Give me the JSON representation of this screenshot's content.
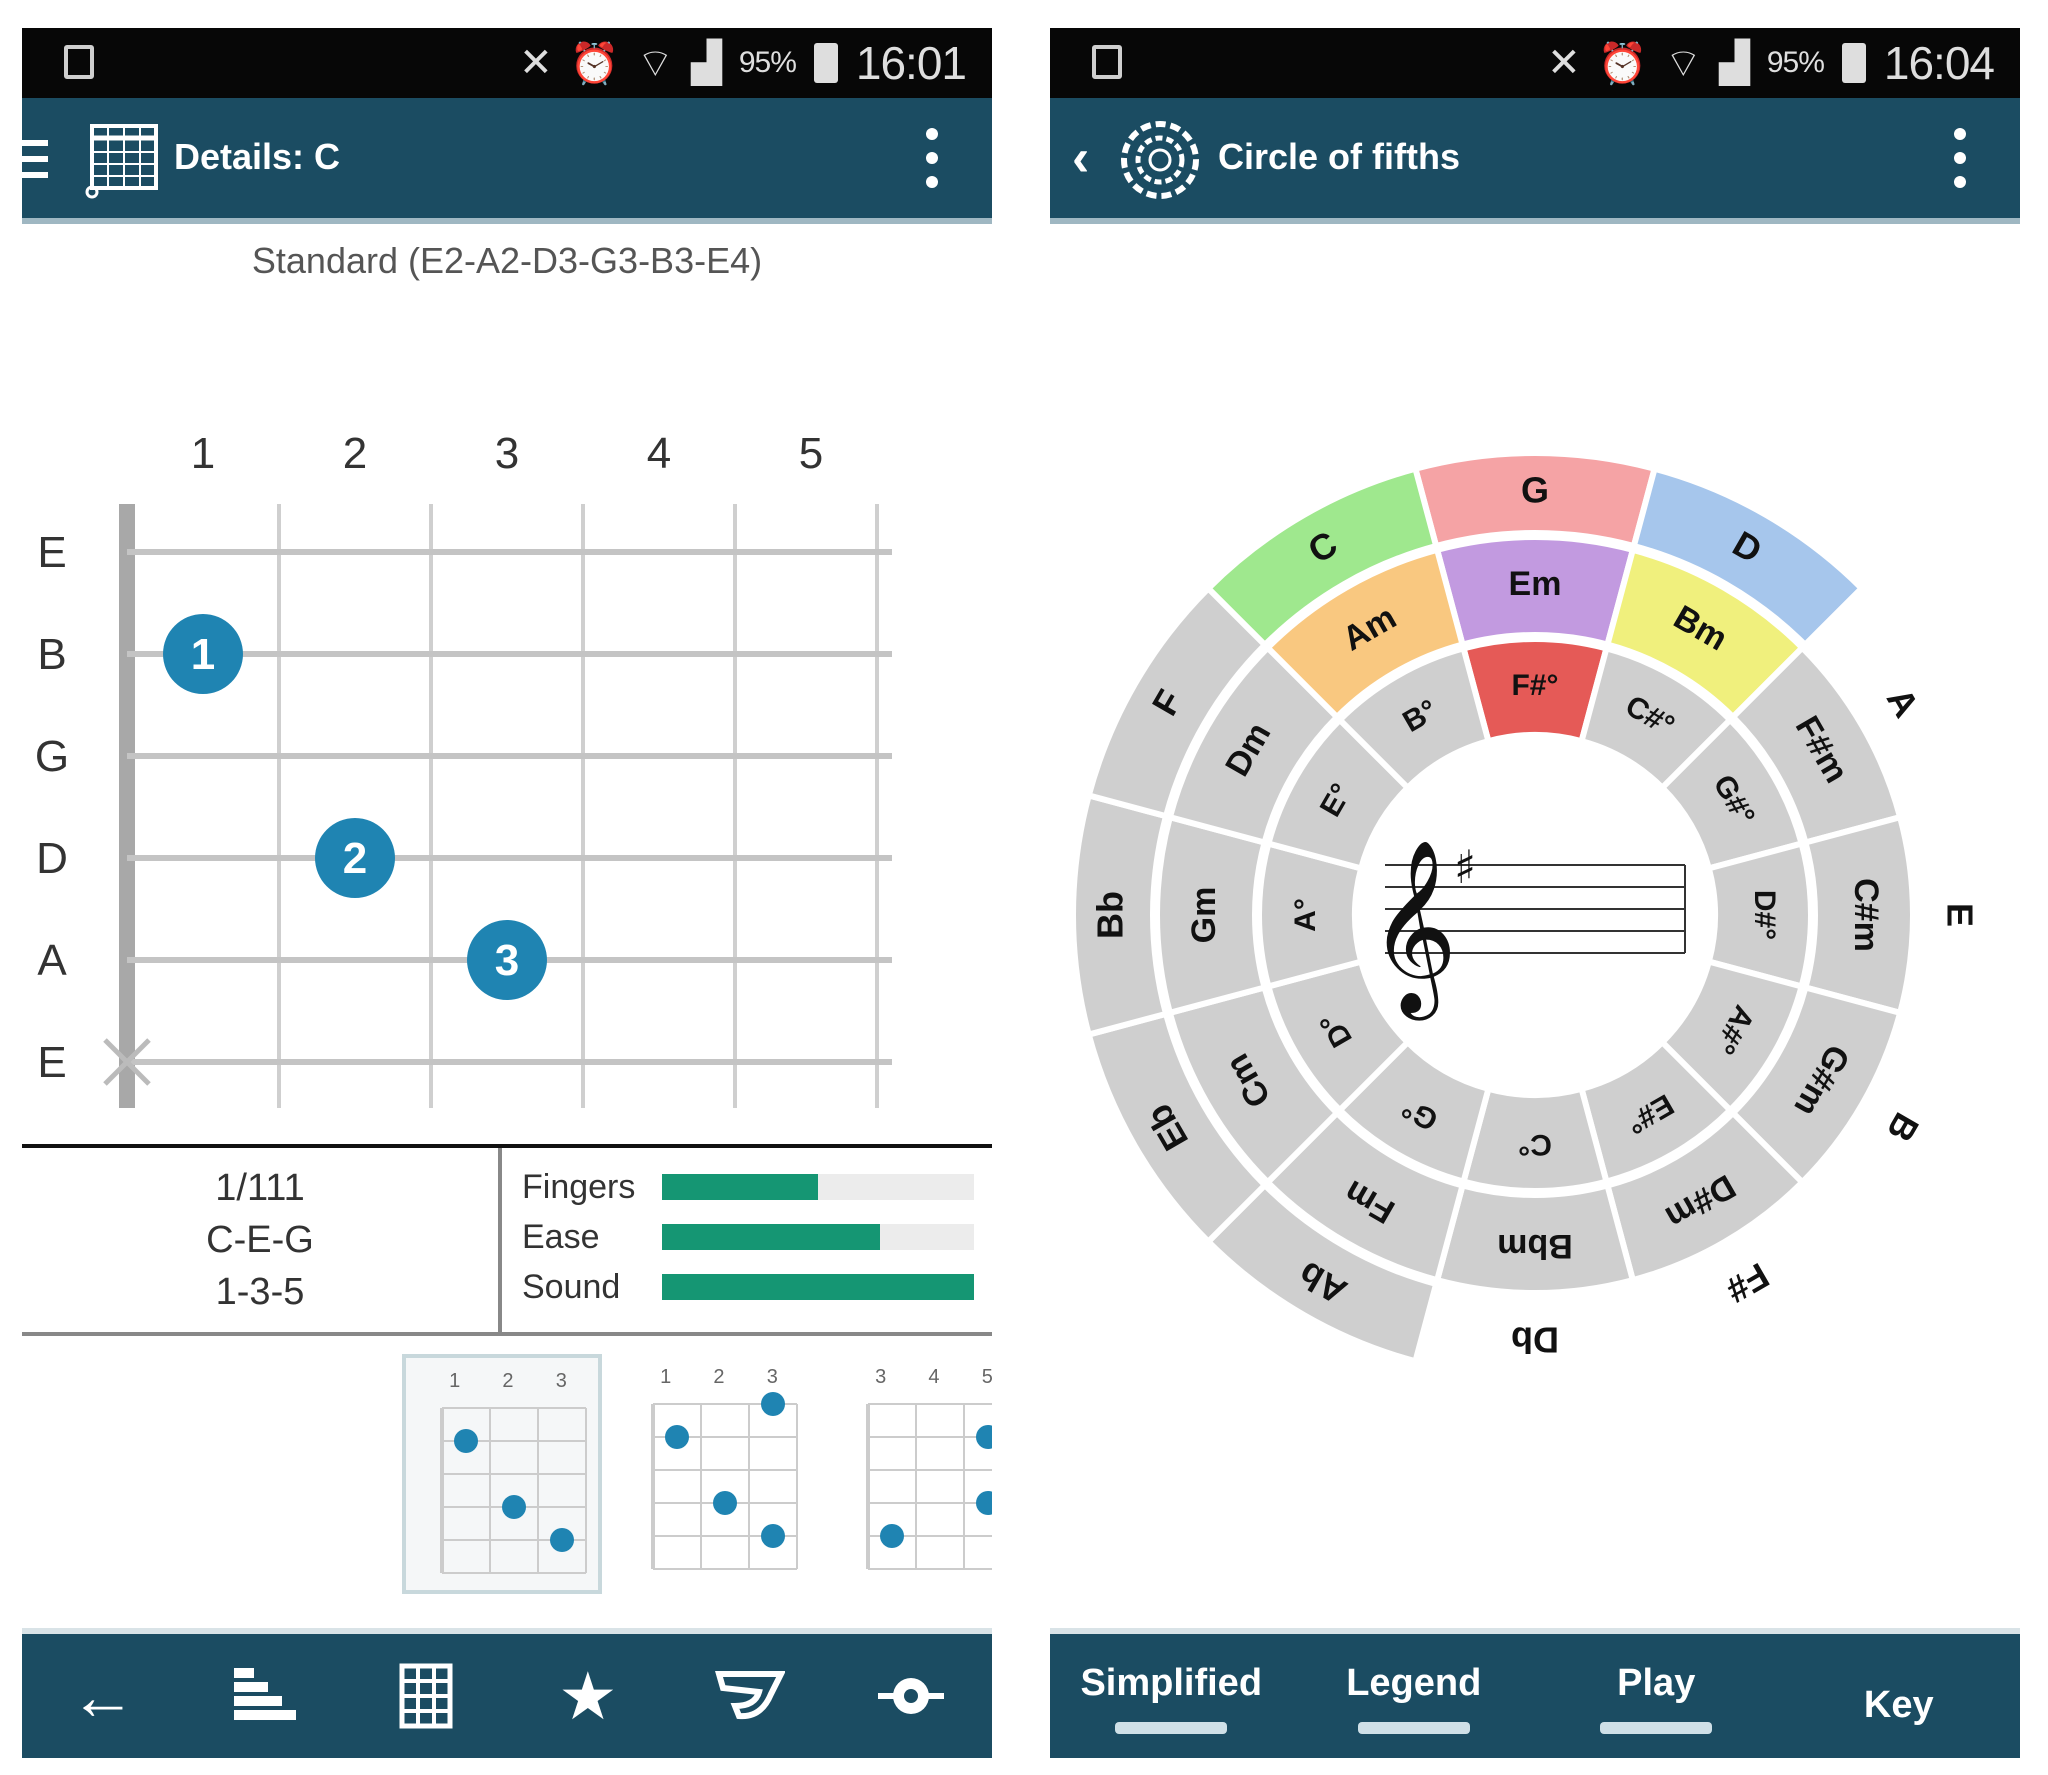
{
  "left_screen": {
    "status": {
      "battery": "95%",
      "time": "16:01"
    },
    "header": {
      "title": "Details: C"
    },
    "tuning": "Standard (E2-A2-D3-G3-B3-E4)",
    "fret_numbers": [
      "1",
      "2",
      "3",
      "4",
      "5"
    ],
    "string_names": [
      "E",
      "B",
      "G",
      "D",
      "A",
      "E"
    ],
    "fingers": [
      {
        "label": "1",
        "string": 1,
        "fret": 1
      },
      {
        "label": "2",
        "string": 3,
        "fret": 2
      },
      {
        "label": "3",
        "string": 4,
        "fret": 3
      }
    ],
    "muted_string": 5,
    "finger_color": "#1f84b2",
    "info": {
      "voicing": "1/111",
      "notes": "C-E-G",
      "intervals": "1-3-5"
    },
    "ratings": [
      {
        "label": "Fingers",
        "value": 0.5
      },
      {
        "label": "Ease",
        "value": 0.7
      },
      {
        "label": "Sound",
        "value": 1.0
      }
    ],
    "thumbnails": [
      {
        "frets": [
          "1",
          "2",
          "3"
        ],
        "selected": true
      },
      {
        "frets": [
          "1",
          "2",
          "3"
        ],
        "selected": false
      },
      {
        "frets": [
          "3",
          "4",
          "5"
        ],
        "selected": false
      }
    ],
    "bottom_icons": [
      "back-arrow-icon",
      "bars-icon",
      "grid-icon",
      "star-icon",
      "guitar-icon",
      "pick-icon"
    ]
  },
  "right_screen": {
    "status": {
      "battery": "95%",
      "time": "16:04"
    },
    "header": {
      "title": "Circle of fifths"
    },
    "center_key_signature": "♯",
    "major_keys": [
      "G",
      "D",
      "A",
      "E",
      "B",
      "F#",
      "Db",
      "Ab",
      "Eb",
      "Bb",
      "F",
      "C"
    ],
    "minor_keys": [
      "Em",
      "Bm",
      "F#m",
      "C#m",
      "G#m",
      "D#m",
      "Bbm",
      "Fm",
      "Cm",
      "Gm",
      "Dm",
      "Am"
    ],
    "diminished_keys": [
      "F#°",
      "C#°",
      "G#°",
      "D#°",
      "A#°",
      "E#°",
      "C°",
      "G°",
      "D°",
      "A°",
      "E°",
      "B°"
    ],
    "highlight_colors": {
      "tonic": "#f5a3a5",
      "dominant": "#a6c6ec",
      "subdominant": "#9fe88e",
      "relative_minor": "#c29ae0",
      "supertonic": "#f0f07d",
      "submediant": "#f9c880",
      "leading_tone": "#e55a57",
      "other": "#cfcfcf",
      "out_of_scale": "#ffffff"
    },
    "tabs": [
      {
        "label": "Simplified",
        "underline": true
      },
      {
        "label": "Legend",
        "underline": true
      },
      {
        "label": "Play",
        "underline": true
      },
      {
        "label": "Key",
        "underline": false
      }
    ]
  }
}
